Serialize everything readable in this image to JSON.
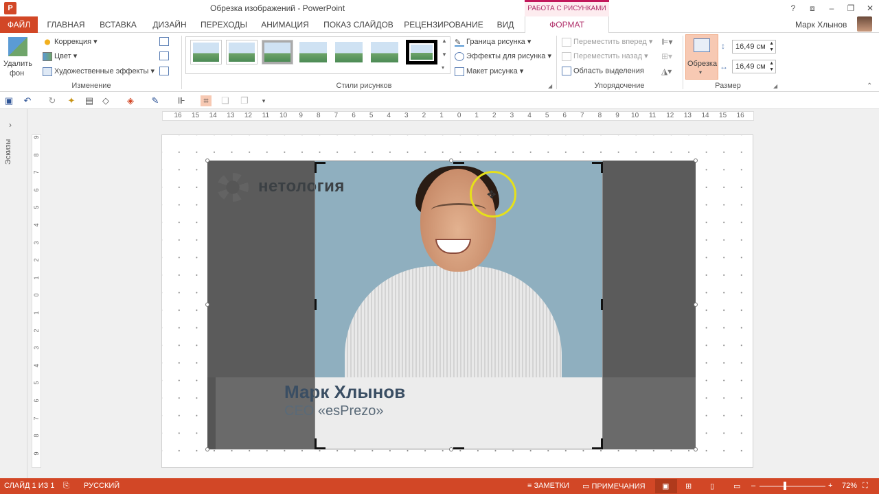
{
  "window": {
    "title": "Обрезка изображений - PowerPoint",
    "context_group": "РАБОТА С РИСУНКАМИ"
  },
  "tabs": [
    "ФАЙЛ",
    "ГЛАВНАЯ",
    "ВСТАВКА",
    "ДИЗАЙН",
    "ПЕРЕХОДЫ",
    "АНИМАЦИЯ",
    "ПОКАЗ СЛАЙДОВ",
    "РЕЦЕНЗИРОВАНИЕ",
    "ВИД",
    "ФОРМАТ"
  ],
  "user": {
    "name": "Марк Хлынов"
  },
  "ribbon": {
    "remove_bg": {
      "line1": "Удалить",
      "line2": "фон"
    },
    "adjust": {
      "correction": "Коррекция",
      "color": "Цвет",
      "artistic": "Художественные эффекты",
      "group": "Изменение"
    },
    "styles": {
      "group": "Стили рисунков",
      "border": "Граница рисунка",
      "effects": "Эффекты для рисунка",
      "layout": "Макет рисунка"
    },
    "arrange": {
      "group": "Упорядочение",
      "forward": "Переместить вперед",
      "backward": "Переместить назад",
      "selection": "Область выделения"
    },
    "size": {
      "group": "Размер",
      "crop": "Обрезка",
      "height": "16,49 см",
      "width": "16,49 см"
    }
  },
  "pane": {
    "thumbnails": "Эскизы"
  },
  "ruler": {
    "h": [
      "16",
      "15",
      "14",
      "13",
      "12",
      "11",
      "10",
      "9",
      "8",
      "7",
      "6",
      "5",
      "4",
      "3",
      "2",
      "1",
      "0",
      "1",
      "2",
      "3",
      "4",
      "5",
      "6",
      "7",
      "8",
      "9",
      "10",
      "11",
      "12",
      "13",
      "14",
      "15",
      "16"
    ],
    "v": [
      "9",
      "8",
      "7",
      "6",
      "5",
      "4",
      "3",
      "2",
      "1",
      "0",
      "1",
      "2",
      "3",
      "4",
      "5",
      "6",
      "7",
      "8",
      "9"
    ]
  },
  "slide": {
    "logo": "нетология",
    "name": "Марк Хлынов",
    "role": "CEO «esPrezo»"
  },
  "status": {
    "slide": "СЛАЙД 1 ИЗ 1",
    "lang": "РУССКИЙ",
    "notes": "ЗАМЕТКИ",
    "comments": "ПРИМЕЧАНИЯ",
    "zoom": "72%"
  },
  "colors": {
    "accent": "#d24726",
    "context": "#b0306a"
  }
}
